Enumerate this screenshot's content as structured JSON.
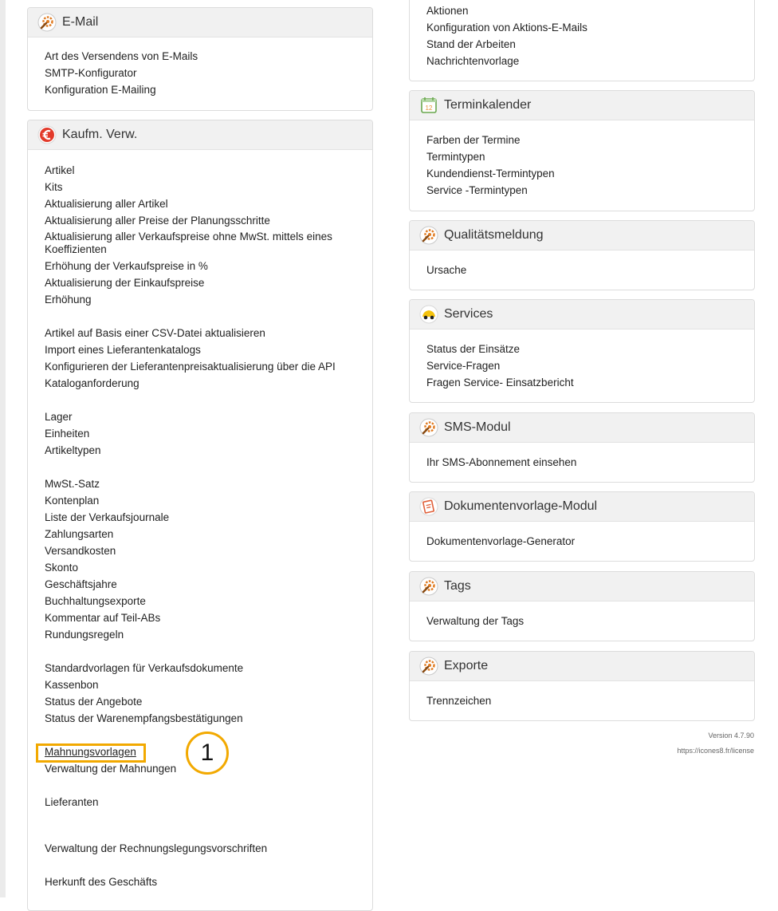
{
  "left": {
    "email": {
      "title": "E-Mail",
      "items": [
        "Art des Versendens von E-Mails",
        "SMTP-Konfigurator",
        "Konfiguration E-Mailing"
      ]
    },
    "kaufm": {
      "title": "Kaufm. Verw.",
      "group1": [
        "Artikel",
        "Kits",
        "Aktualisierung aller Artikel",
        "Aktualisierung aller Preise der Planungsschritte"
      ],
      "wrapped": "Aktualisierung aller Verkaufspreise ohne MwSt. mittels eines Koeffizienten",
      "group1b": [
        "Erhöhung der Verkaufspreise in %",
        "Aktualisierung der Einkaufspreise",
        "Erhöhung"
      ],
      "group2": [
        "Artikel auf Basis einer CSV-Datei aktualisieren",
        "Import eines Lieferantenkatalogs",
        "Konfigurieren der Lieferantenpreisaktualisierung über die API",
        "Kataloganforderung"
      ],
      "group3": [
        "Lager",
        "Einheiten",
        "Artikeltypen"
      ],
      "group4": [
        "MwSt.-Satz",
        "Kontenplan",
        "Liste der Verkaufsjournale",
        "Zahlungsarten",
        "Versandkosten",
        "Skonto",
        "Geschäftsjahre",
        "Buchhaltungsexporte",
        "Kommentar auf Teil-ABs",
        "Rundungsregeln"
      ],
      "group5": [
        "Standardvorlagen für Verkaufsdokumente",
        "Kassenbon",
        "Status der Angebote",
        "Status der Warenempfangsbestätigungen"
      ],
      "group6": [
        "Mahnungsvorlagen",
        "Verwaltung der Mahnungen"
      ],
      "group7": [
        "Lieferanten"
      ],
      "group8": [
        "Verwaltung der Rechnungslegungsvorschriften"
      ],
      "group9": [
        "Herkunft des Geschäfts"
      ]
    }
  },
  "right": {
    "top_items": [
      "Aktionen",
      "Konfiguration von Aktions-E-Mails",
      "Stand der Arbeiten",
      "Nachrichtenvorlage"
    ],
    "terminkalender": {
      "title": "Terminkalender",
      "items": [
        "Farben der Termine",
        "Termintypen",
        "Kundendienst-Termintypen",
        "Service -Termintypen"
      ]
    },
    "qualitaet": {
      "title": "Qualitätsmeldung",
      "items": [
        "Ursache"
      ]
    },
    "services": {
      "title": "Services",
      "items": [
        "Status der Einsätze",
        "Service-Fragen",
        "Fragen Service- Einsatzbericht"
      ]
    },
    "sms": {
      "title": "SMS-Modul",
      "items": [
        "Ihr SMS-Abonnement einsehen"
      ]
    },
    "dokument": {
      "title": "Dokumentenvorlage-Modul",
      "items": [
        "Dokumentenvorlage-Generator"
      ]
    },
    "tags": {
      "title": "Tags",
      "items": [
        "Verwaltung der Tags"
      ]
    },
    "exporte": {
      "title": "Exporte",
      "items": [
        "Trennzeichen"
      ]
    }
  },
  "footer": {
    "version": "Version 4.7.90",
    "license": "https://icones8.fr/license"
  },
  "annotation": {
    "step": "1"
  },
  "colors": {
    "highlight": "#f2a900",
    "header_bg": "#f1f1f1"
  },
  "icons": {
    "email": "gear-wrench-icon",
    "kaufm": "euro-icon",
    "terminkalender": "calendar-icon",
    "qualitaet": "gear-wrench-icon",
    "services": "service-car-icon",
    "sms": "gear-wrench-icon",
    "dokument": "document-template-icon",
    "tags": "gear-wrench-icon",
    "exporte": "gear-wrench-icon"
  }
}
